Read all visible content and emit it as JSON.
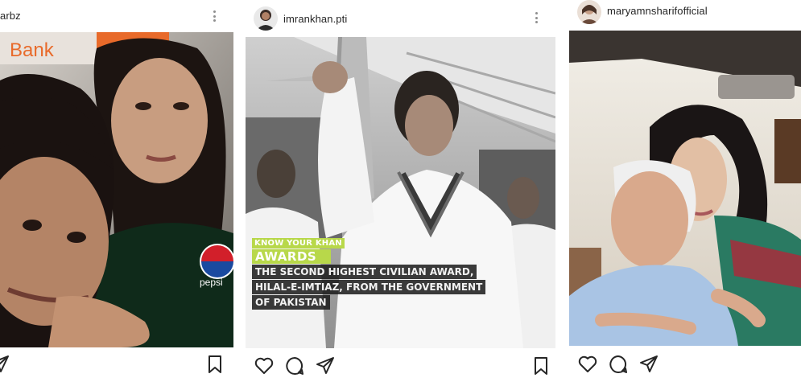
{
  "posts": [
    {
      "username": "arbz",
      "photo_text": {
        "sign_left": "Bank",
        "pepsi": "pepsi"
      }
    },
    {
      "username": "imrankhan.pti",
      "overlay": {
        "kicker": "KNOW YOUR KHAN",
        "title": "AWARDS",
        "lines": [
          "THE SECOND HIGHEST CIVILIAN AWARD,",
          "HILAL-E-IMTIAZ, FROM THE GOVERNMENT",
          "OF PAKISTAN"
        ]
      }
    },
    {
      "username": "maryamnsharifofficial"
    }
  ],
  "icons": {
    "like": "heart-icon",
    "comment": "comment-icon",
    "share": "send-icon",
    "save": "bookmark-icon",
    "more": "more-icon"
  },
  "colors": {
    "accent_green": "#b8d84a",
    "icon": "#262626",
    "secondary": "#8e8e8e"
  }
}
